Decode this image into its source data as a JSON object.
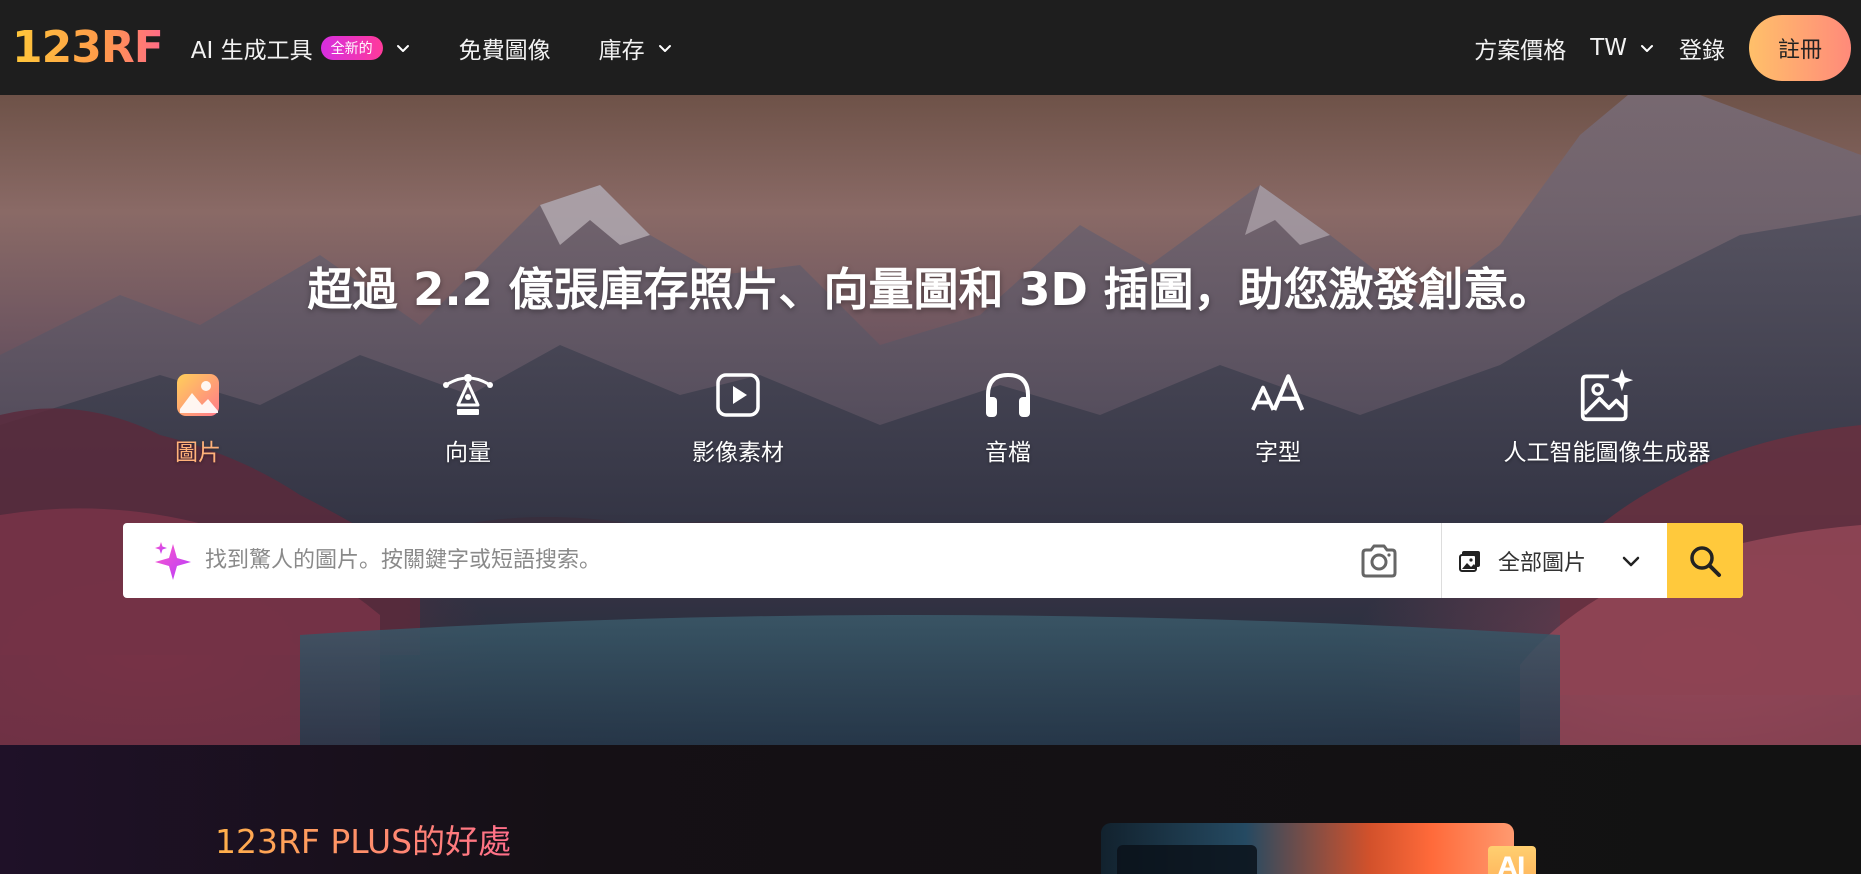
{
  "header": {
    "logo": "123RF",
    "nav": {
      "ai_tools": "AI 生成工具",
      "ai_badge": "全新的",
      "free_images": "免費圖像",
      "stock": "庫存"
    },
    "right": {
      "pricing": "方案價格",
      "region": "TW",
      "login": "登錄",
      "signup": "註冊"
    }
  },
  "hero": {
    "headline": "超過 2.2 億張庫存照片、向量圖和 3D 插圖，助您激發創意。",
    "categories": [
      {
        "label": "圖片",
        "icon": "image-icon",
        "active": true
      },
      {
        "label": "向量",
        "icon": "pen-tool-icon",
        "active": false
      },
      {
        "label": "影像素材",
        "icon": "video-play-icon",
        "active": false
      },
      {
        "label": "音檔",
        "icon": "headphones-icon",
        "active": false
      },
      {
        "label": "字型",
        "icon": "font-icon",
        "active": false
      },
      {
        "label": "人工智能圖像生成器",
        "icon": "ai-image-icon",
        "active": false
      }
    ],
    "search": {
      "placeholder": "找到驚人的圖片。按關鍵字或短語搜索。",
      "value": "",
      "type_selected": "全部圖片"
    }
  },
  "bottom": {
    "plus_title": "123RF PLUS的好處",
    "ai_tag": "AI"
  },
  "colors": {
    "header_bg": "#1e1e1e",
    "accent_yellow": "#ffc93c",
    "active_category": "#ffb27a",
    "badge": "#d62ee0"
  }
}
